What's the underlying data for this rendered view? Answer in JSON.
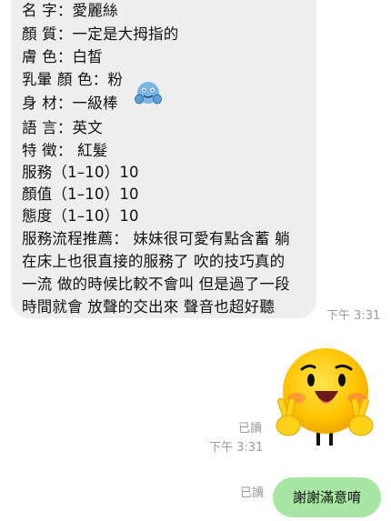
{
  "message_in": {
    "lines": [
      "名 字：愛麗絲",
      "顏 質：一定是大拇指的",
      "膚 色：白皙",
      "乳暈 顏 色：粉",
      "身 材：一級棒",
      "語 言：英文",
      "特 徵： 紅髮",
      "服務（1–10）10",
      "顏值（1–10）10",
      "態度（1–10）10",
      "服務流程推薦： 妹妹很可愛有點含蓄 躺",
      "在床上也很直接的服務了 吹的技巧真的",
      "一流 做的時候比較不會叫 但是過了一段",
      "時間就會 放聲的交出來 聲音也超好聽"
    ],
    "time": "下午 3:31",
    "emoji_icon": "hugging-face-icon"
  },
  "sticker_message": {
    "icon": "yellow-face-victory-sticker",
    "read": "已讀",
    "time": "下午 3:31"
  },
  "message_out": {
    "text": "謝謝滿意唷",
    "read": "已讀"
  },
  "colors": {
    "incoming_bubble": "#eeeeef",
    "outgoing_bubble": "#a8e6a3",
    "meta_text": "#9b9b9b"
  }
}
